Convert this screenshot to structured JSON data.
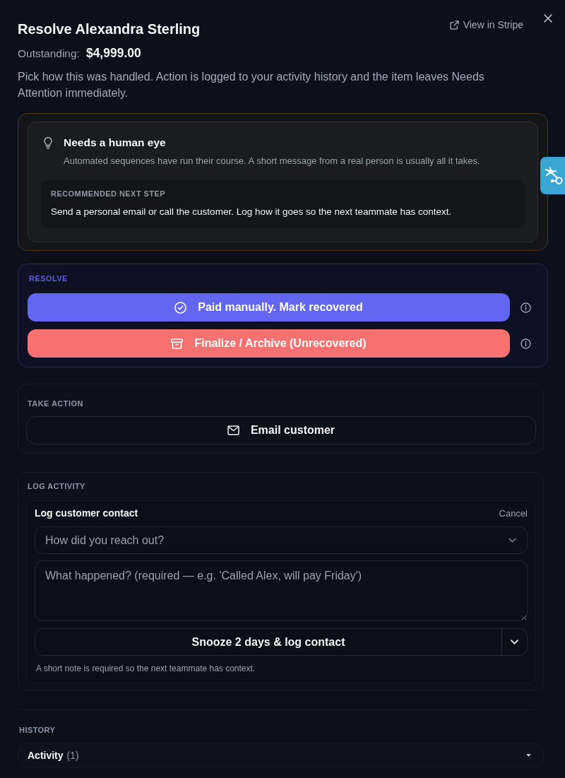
{
  "header": {
    "title": "Resolve Alexandra Sterling",
    "link": "View in Stripe",
    "outstanding_label": "Outstanding:",
    "outstanding_amount": "$4,999.00",
    "description": "Pick how this was handled. Action is logged to your activity history and the item leaves Needs Attention immediately."
  },
  "insight": {
    "title": "Needs a human eye",
    "body": "Automated sequences have run their course. A short message from a real person is usually all it takes.",
    "next_step_label": "RECOMMENDED NEXT STEP",
    "next_step": "Send a personal email or call the customer. Log how it goes so the next teammate has context."
  },
  "resolve": {
    "label": "RESOLVE",
    "actions": [
      {
        "kind": "recover",
        "label": "Paid manually. Mark recovered"
      },
      {
        "kind": "archive",
        "label": "Finalize / Archive (Unrecovered)"
      }
    ]
  },
  "take_action": {
    "label": "TAKE ACTION",
    "button": "Email customer"
  },
  "log_activity": {
    "label": "LOG ACTIVITY",
    "form": {
      "title": "Log customer contact",
      "cancel": "Cancel",
      "method": {
        "placeholder": "How did you reach out?"
      },
      "note": {
        "placeholder": "What happened? (required — e.g. 'Called Alex, will pay Friday')"
      },
      "submit": "Snooze 2 days & log contact",
      "hint": "A short note is required so the next teammate has context."
    }
  },
  "history": {
    "label": "HISTORY",
    "items": [
      {
        "label": "Activity",
        "count": "(1)",
        "expanded": false
      }
    ]
  }
}
